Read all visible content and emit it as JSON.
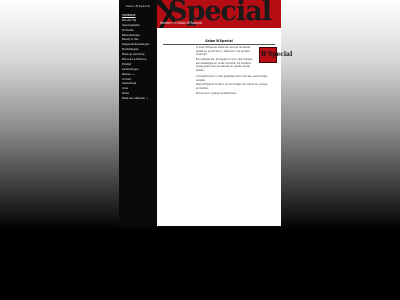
{
  "sidebar": {
    "brand": "Salon B'Special",
    "items": [
      {
        "label": "HOMEPAGE",
        "active": true
      },
      {
        "label": "Wie Zijn Wij"
      },
      {
        "label": "Openingstijden"
      },
      {
        "label": "Producten"
      },
      {
        "label": "Behandelingen"
      },
      {
        "label": "Beauty & Hair"
      },
      {
        "label": "Kappersbehandelingen"
      },
      {
        "label": "Bruidskapsels"
      },
      {
        "label": "Make-up workshop"
      },
      {
        "label": "Manicure & Pedicure"
      },
      {
        "label": "Prijslijst"
      },
      {
        "label": "Aanbiedingen"
      },
      {
        "label": "Nieuws",
        "arrow": "▸"
      },
      {
        "label": "Contact"
      },
      {
        "label": "Gastenboek"
      },
      {
        "label": "Links"
      },
      {
        "label": "Route"
      },
      {
        "label": "Maak een afspraak",
        "arrow": "▸"
      }
    ]
  },
  "header": {
    "logo_text": "Special",
    "tagline": "Welkom in Salon B'Special"
  },
  "main": {
    "title": "Salon B'Special",
    "paragraphs": [
      "In salon B'Special staat het doel op de eerste plaats en wordt door u alles tot in de puntjes verzorgd.",
      "Een bezoek aan de kapper is voor vele mensen een feestelijke en uniek moment, wij luisteren graag goed naar uw wensen en geven eerlijk advies.",
      "U treedt binnen in een gezellige salon met een persoonlijke aanpak.",
      "Salon B'Special houdt u op de hoogte van trends en nieuwe producten.",
      "Wij kunnen u graag verwelkomen!"
    ],
    "promo_logo": "B'Special"
  },
  "colors": {
    "brand_red": "#b40d14",
    "sidebar_bg": "#0a0a0a"
  }
}
